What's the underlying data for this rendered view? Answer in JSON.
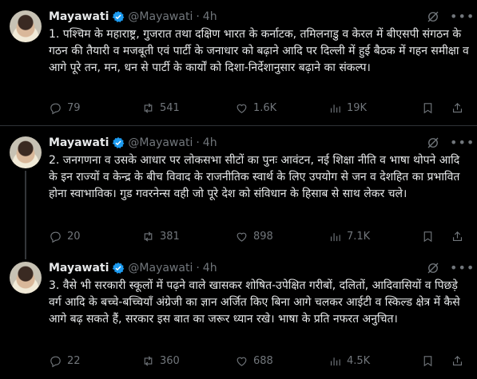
{
  "tweets": [
    {
      "author": "Mayawati",
      "handle": "@Mayawati",
      "separator": "·",
      "time": "4h",
      "text": "1. पश्चिम के महाराष्ट्र, गुजरात तथा दक्षिण भारत के कर्नाटक, तमिलनाडु व केरल में बीएसपी संगठन के गठन की तैयारी व मजबूती एवं पार्टी के जनाधार को बढ़ाने आदि पर दिल्ली में हुई बैठक में गहन समीक्षा व आगे पूरे तन, मन, धन से पार्टी के कार्यों को दिशा-निर्देशानुसार बढ़ाने का संकल्प।",
      "replies": "79",
      "reposts": "541",
      "likes": "1.6K",
      "views": "19K"
    },
    {
      "author": "Mayawati",
      "handle": "@Mayawati",
      "separator": "·",
      "time": "4h",
      "text": "2. जनगणना व उसके आधार पर लोकसभा सीटों का पुनः आवंटन, नई शिक्षा नीति व भाषा थोपने आदि के इन राज्यों व केन्द्र के बीच विवाद के राजनीतिक स्वार्थ के लिए उपयोग से जन व देशहित का प्रभावित होना स्वाभाविक। गुड गवरनेन्स वही जो पूरे देश को संविधान के हिसाब से साथ लेकर चले।",
      "replies": "20",
      "reposts": "381",
      "likes": "898",
      "views": "7.1K"
    },
    {
      "author": "Mayawati",
      "handle": "@Mayawati",
      "separator": "·",
      "time": "4h",
      "text": "3. वैसे भी सरकारी स्कूलों में पढ़ने वाले खासकर शोषित-उपेक्षित गरीबों, दलितों, आदिवासियों व पिछड़े वर्ग आदि के बच्चे-बच्चियाँ अंग्रेजी का ज्ञान अर्जित किए बिना आगे चलकर आईटी व स्किल्ड क्षेत्र में कैसे आगे बढ़ सकते हैं, सरकार इस बात का जरूर ध्यान रखे। भाषा के प्रति नफरत अनुचित।",
      "replies": "22",
      "reposts": "360",
      "likes": "688",
      "views": "4.5K"
    }
  ],
  "colors": {
    "background": "#000000",
    "text": "#e7e9ea",
    "muted": "#71767b",
    "verified": "#1d9bf0",
    "divider": "#2f3336"
  },
  "icons": [
    "verified-badge-icon",
    "grok-icon",
    "more-icon",
    "reply-icon",
    "repost-icon",
    "like-icon",
    "views-icon",
    "bookmark-icon",
    "share-icon"
  ]
}
